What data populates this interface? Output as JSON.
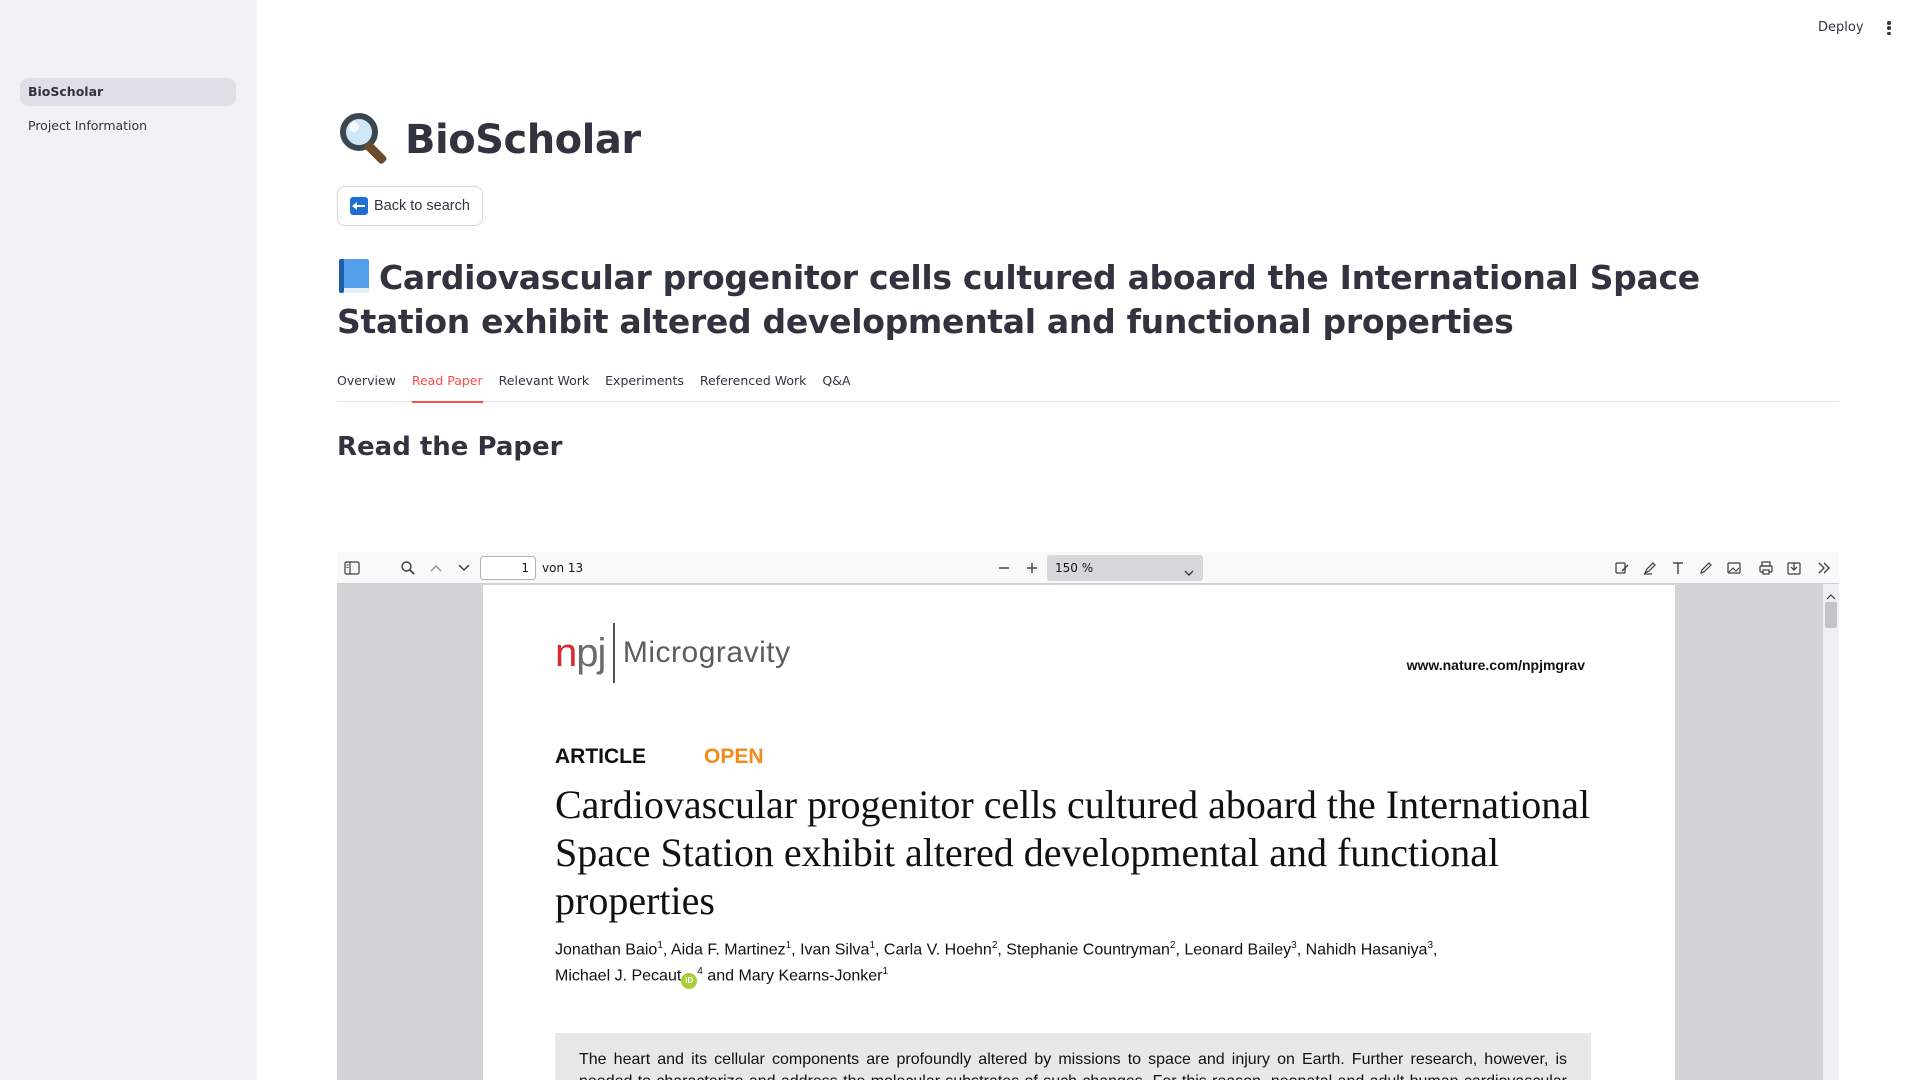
{
  "sidebar": {
    "items": [
      {
        "label": "BioScholar",
        "active": true
      },
      {
        "label": "Project Information",
        "active": false
      }
    ]
  },
  "header": {
    "deploy_label": "Deploy",
    "menu_icon": "kebab-menu-icon"
  },
  "app": {
    "title": "BioScholar",
    "title_icon": "magnifying-glass-icon"
  },
  "back_button": {
    "label": "Back to search",
    "icon": "left-arrow-icon"
  },
  "paper": {
    "title": "Cardiovascular progenitor cells cultured aboard the International Space Station exhibit altered developmental and functional properties",
    "title_icon": "blue-book-icon"
  },
  "tabs": [
    {
      "label": "Overview",
      "active": false
    },
    {
      "label": "Read Paper",
      "active": true
    },
    {
      "label": "Relevant Work",
      "active": false
    },
    {
      "label": "Experiments",
      "active": false
    },
    {
      "label": "Referenced Work",
      "active": false
    },
    {
      "label": "Q&A",
      "active": false
    }
  ],
  "section_heading": "Read the Paper",
  "pdf_viewer": {
    "page_number": "1",
    "page_of": "von 13",
    "zoom": "150 %",
    "colors": {
      "toolbar_bg": "#f9f9fa",
      "viewer_bg": "#d4d4d7"
    }
  },
  "pdf_page": {
    "logo_n": "n",
    "logo_pj": "pj",
    "journal": "Microgravity",
    "url": "www.nature.com/npjmgrav",
    "article_label": "ARTICLE",
    "open_label": "OPEN",
    "title": "Cardiovascular progenitor cells cultured aboard the International Space Station exhibit altered developmental and functional properties",
    "authors": [
      {
        "name": "Jonathan Baio",
        "sup": "1"
      },
      {
        "name": "Aida F. Martinez",
        "sup": "1"
      },
      {
        "name": "Ivan Silva",
        "sup": "1"
      },
      {
        "name": "Carla V. Hoehn",
        "sup": "2"
      },
      {
        "name": "Stephanie Countryman",
        "sup": "2"
      },
      {
        "name": "Leonard Bailey",
        "sup": "3"
      },
      {
        "name": "Nahidh Hasaniya",
        "sup": "3"
      },
      {
        "name": "Michael J. Pecaut",
        "sup": "4"
      },
      {
        "name": "Mary Kearns-Jonker",
        "sup": "1"
      }
    ],
    "orcid_label": "iD",
    "and_label": "and",
    "abstract": "The heart and its cellular components are profoundly altered by missions to space and injury on Earth. Further research, however, is needed to characterize and address the molecular substrates of such changes. For this reason, neonatal and adult human cardiovascular progenitor cells (CPCs) were cultured aboard the International Space Station. Upon return to Earth, we measured"
  },
  "colors": {
    "accent": "#ff4b4b",
    "sidebar_bg": "#f0f2f6",
    "text": "#31333f",
    "npj_red": "#d9282f",
    "open_orange": "#f28b1c"
  }
}
